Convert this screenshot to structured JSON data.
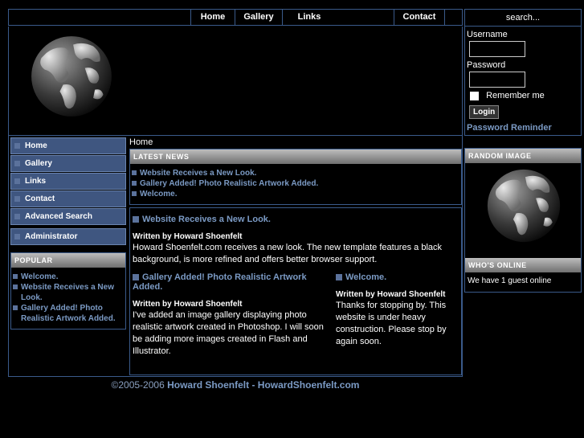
{
  "nav": {
    "items": [
      "Home",
      "Gallery",
      "Links",
      "Contact"
    ]
  },
  "search": {
    "value": "search..."
  },
  "login": {
    "username_label": "Username",
    "password_label": "Password",
    "remember_label": "Remember me",
    "button": "Login",
    "reminder": "Password Reminder"
  },
  "sidebar": {
    "items": [
      "Home",
      "Gallery",
      "Links",
      "Contact",
      "Advanced Search"
    ],
    "admin": "Administrator",
    "popular_title": "POPULAR",
    "popular": [
      "Welcome.",
      "Website Receives a New Look.",
      "Gallery Added! Photo Realistic Artwork Added."
    ]
  },
  "breadcrumb": "Home",
  "latest": {
    "title": "LATEST NEWS",
    "items": [
      "Website Receives a New Look.",
      "Gallery Added! Photo Realistic Artwork Added.",
      "Welcome."
    ]
  },
  "articles": [
    {
      "title": "Website Receives a New Look.",
      "byline": "Written by Howard Shoenfelt",
      "text": "Howard Shoenfelt.com receives a new look. The new template features a black background, is more refined and offers better browser support."
    },
    {
      "title": "Gallery Added! Photo Realistic Artwork Added.",
      "byline": "Written by Howard Shoenfelt",
      "text": "I've added an image gallery displaying photo realistic artwork created in Photoshop. I will soon be adding more images created in Flash and Illustrator."
    },
    {
      "title": "Welcome.",
      "byline": "Written by Howard Shoenfelt",
      "text": "Thanks for stopping by. This website is under heavy construction. Please stop by again soon."
    }
  ],
  "random_image": {
    "title": "RANDOM IMAGE"
  },
  "whos_online": {
    "title": "WHO'S ONLINE",
    "text": "We have 1 guest online"
  },
  "footer": {
    "copyright": "©2005-2006",
    "name": "Howard Shoenfelt",
    "sep": "-",
    "site": "HowardShoenfelt.com"
  },
  "colors": {
    "accent": "#7b9ac4",
    "menu_bg": "#3f5680",
    "border": "#3a5a8a"
  }
}
